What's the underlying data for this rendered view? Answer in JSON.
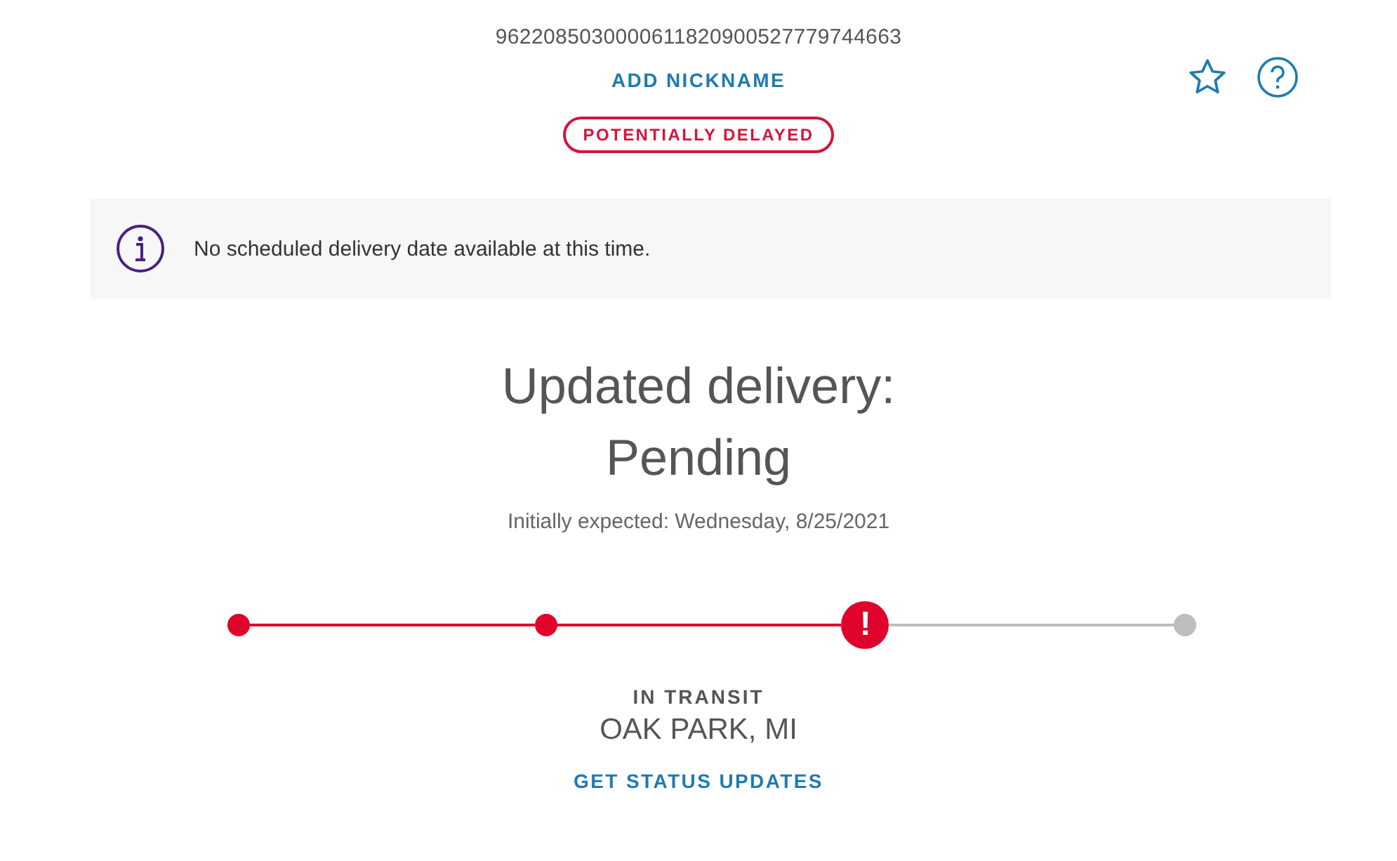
{
  "tracking_number": "9622085030000611820900527779744663",
  "nickname_link": "ADD NICKNAME",
  "status_badge": "POTENTIALLY DELAYED",
  "info_banner": {
    "text": "No scheduled delivery date available at this time."
  },
  "delivery": {
    "heading_line_1": "Updated delivery:",
    "heading_line_2": "Pending",
    "initially_expected": "Initially expected: Wednesday, 8/25/2021"
  },
  "progress_steps": [
    {
      "kind": "done"
    },
    {
      "kind": "done"
    },
    {
      "kind": "alert",
      "alert_mark": "!"
    },
    {
      "kind": "pending"
    }
  ],
  "current_status": {
    "label": "IN TRANSIT",
    "location": "OAK PARK, MI"
  },
  "status_updates_link": "GET STATUS UPDATES"
}
